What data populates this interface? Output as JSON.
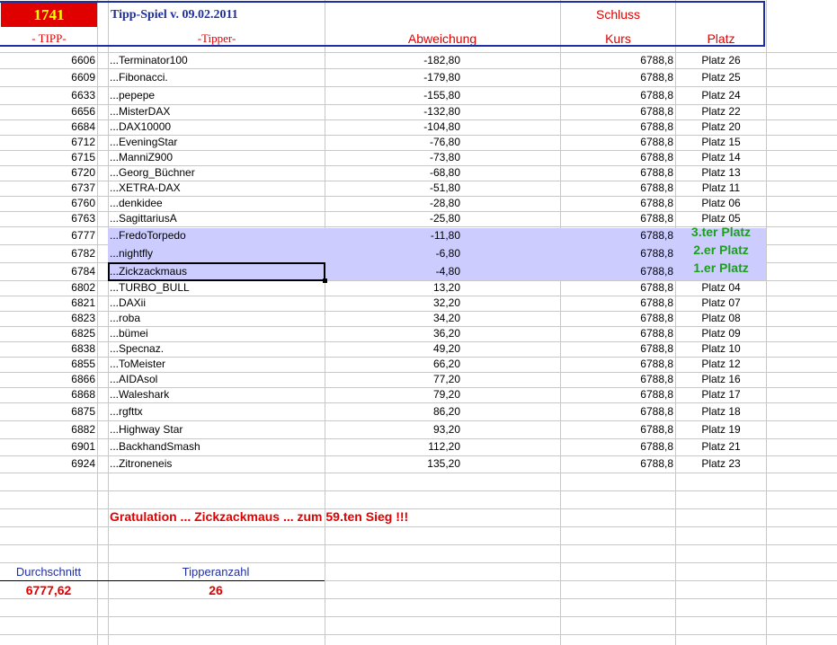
{
  "header": {
    "count": "1741",
    "title": "Tipp-Spiel v. 09.02.2011",
    "schluss": "Schluss",
    "col_tipp": "- TIPP-",
    "col_tipper": "-Tipper-",
    "col_abweichung": "Abweichung",
    "col_kurs": "Kurs",
    "col_platz": "Platz"
  },
  "rows": [
    {
      "tipp": "6606",
      "tipper": "...Terminator100",
      "abw": "-182,80",
      "kurs": "6788,8",
      "platz": "Platz 26"
    },
    {
      "tipp": "6609",
      "tipper": "...Fibonacci.",
      "abw": "-179,80",
      "kurs": "6788,8",
      "platz": "Platz 25"
    },
    {
      "tipp": "6633",
      "tipper": "...pepepe",
      "abw": "-155,80",
      "kurs": "6788,8",
      "platz": "Platz 24"
    },
    {
      "tipp": "6656",
      "tipper": "...MisterDAX",
      "abw": "-132,80",
      "kurs": "6788,8",
      "platz": "Platz 22"
    },
    {
      "tipp": "6684",
      "tipper": "...DAX10000",
      "abw": "-104,80",
      "kurs": "6788,8",
      "platz": "Platz 20"
    },
    {
      "tipp": "6712",
      "tipper": "...EveningStar",
      "abw": "-76,80",
      "kurs": "6788,8",
      "platz": "Platz 15"
    },
    {
      "tipp": "6715",
      "tipper": "...ManniZ900",
      "abw": "-73,80",
      "kurs": "6788,8",
      "platz": "Platz 14"
    },
    {
      "tipp": "6720",
      "tipper": "...Georg_Büchner",
      "abw": "-68,80",
      "kurs": "6788,8",
      "platz": "Platz 13"
    },
    {
      "tipp": "6737",
      "tipper": "...XETRA-DAX",
      "abw": "-51,80",
      "kurs": "6788,8",
      "platz": "Platz 11"
    },
    {
      "tipp": "6760",
      "tipper": "...denkidee",
      "abw": "-28,80",
      "kurs": "6788,8",
      "platz": "Platz 06"
    },
    {
      "tipp": "6763",
      "tipper": "...SagittariusA",
      "abw": "-25,80",
      "kurs": "6788,8",
      "platz": "Platz 05"
    },
    {
      "tipp": "6777",
      "tipper": "...FredoTorpedo",
      "abw": "-11,80",
      "kurs": "6788,8",
      "platz": "3.ter Platz"
    },
    {
      "tipp": "6782",
      "tipper": "...nightfly",
      "abw": "-6,80",
      "kurs": "6788,8",
      "platz": "2.er Platz"
    },
    {
      "tipp": "6784",
      "tipper": "...Zickzackmaus",
      "abw": "-4,80",
      "kurs": "6788,8",
      "platz": "1.er Platz"
    },
    {
      "tipp": "6802",
      "tipper": "...TURBO_BULL",
      "abw": "13,20",
      "kurs": "6788,8",
      "platz": "Platz 04"
    },
    {
      "tipp": "6821",
      "tipper": "...DAXii",
      "abw": "32,20",
      "kurs": "6788,8",
      "platz": "Platz 07"
    },
    {
      "tipp": "6823",
      "tipper": "...roba",
      "abw": "34,20",
      "kurs": "6788,8",
      "platz": "Platz 08"
    },
    {
      "tipp": "6825",
      "tipper": "...bümei",
      "abw": "36,20",
      "kurs": "6788,8",
      "platz": "Platz 09"
    },
    {
      "tipp": "6838",
      "tipper": "...Specnaz.",
      "abw": "49,20",
      "kurs": "6788,8",
      "platz": "Platz 10"
    },
    {
      "tipp": "6855",
      "tipper": "...ToMeister",
      "abw": "66,20",
      "kurs": "6788,8",
      "platz": "Platz 12"
    },
    {
      "tipp": "6866",
      "tipper": "...AIDAsol",
      "abw": "77,20",
      "kurs": "6788,8",
      "platz": "Platz 16"
    },
    {
      "tipp": "6868",
      "tipper": "...Waleshark",
      "abw": "79,20",
      "kurs": "6788,8",
      "platz": "Platz 17"
    },
    {
      "tipp": "6875",
      "tipper": "...rgfttx",
      "abw": "86,20",
      "kurs": "6788,8",
      "platz": "Platz 18"
    },
    {
      "tipp": "6882",
      "tipper": "...Highway Star",
      "abw": "93,20",
      "kurs": "6788,8",
      "platz": "Platz 19"
    },
    {
      "tipp": "6901",
      "tipper": "...BackhandSmash",
      "abw": "112,20",
      "kurs": "6788,8",
      "platz": "Platz 21"
    },
    {
      "tipp": "6924",
      "tipper": "...Zitroneneis",
      "abw": "135,20",
      "kurs": "6788,8",
      "platz": "Platz 23"
    }
  ],
  "gratulation": "Gratulation ... Zickzackmaus ... zum  59.ten Sieg !!!",
  "footer": {
    "durchschnitt_label": "Durchschnitt",
    "durchschnitt_value": "6777,62",
    "tipperanzahl_label": "Tipperanzahl",
    "tipperanzahl_value": "26"
  },
  "colors": {
    "highlight": "#ccccff",
    "header_red": "#e00000",
    "title_blue": "#1f2fa0",
    "count_bg": "#e00000",
    "count_text": "#ffff00",
    "podium_green": "#1e9e1e"
  }
}
